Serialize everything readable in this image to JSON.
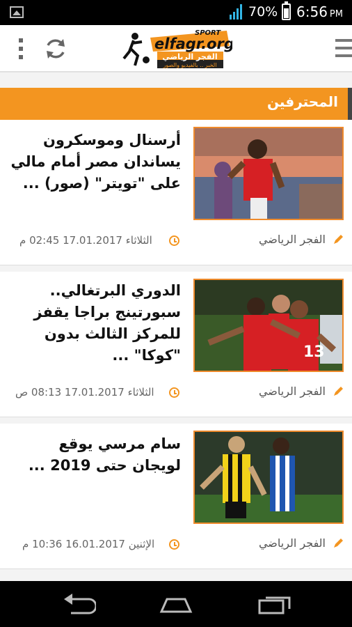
{
  "status_bar": {
    "battery_percent": "70%",
    "time": "6:56",
    "ampm": "PM"
  },
  "app_bar": {
    "logo_text": "elfagr.org",
    "logo_sport": "SPORT",
    "logo_arabic": "الفجر الرياضي",
    "logo_tagline": "الخبر .. بالفيديو والصور"
  },
  "section": {
    "title": "المحترفين",
    "accent": "#f39520"
  },
  "articles": [
    {
      "headline": "أرسنال وموسكرون يساندان مصر أمام مالي على \"تويتر\" (صور) ...",
      "date": "الثلاثاء 17.01.2017 02:45 م",
      "source": "الفجر الرياضي"
    },
    {
      "headline": "الدوري البرتغالي.. سبورتينج براجا يقفز للمركز الثالث بدون \"كوكا\" ...",
      "date": "الثلاثاء 17.01.2017 08:13 ص",
      "source": "الفجر الرياضي"
    },
    {
      "headline": "سام مرسي يوقع لويجان حتى 2019 ...",
      "date": "الإثنين 16.01.2017 10:36 م",
      "source": "الفجر الرياضي"
    }
  ]
}
